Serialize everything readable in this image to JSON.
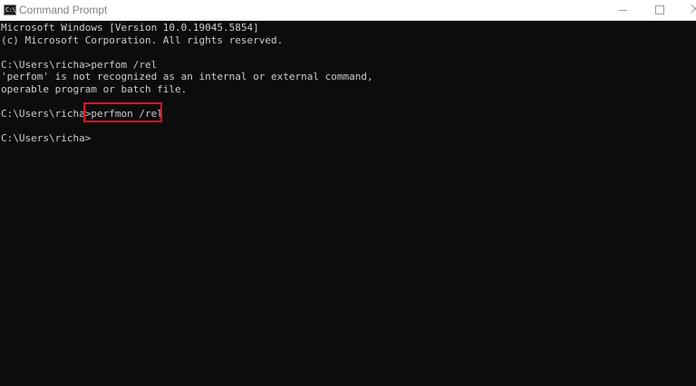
{
  "window": {
    "title": "Command Prompt",
    "app_icon_glyph": "C:\\"
  },
  "console": {
    "lines": [
      "Microsoft Windows [Version 10.0.19045.5854]",
      "(c) Microsoft Corporation. All rights reserved.",
      "C:\\Users\\richa>perfom /rel",
      "'perfom' is not recognized as an internal or external command,",
      "operable program or batch file.",
      "C:\\Users\\richa>perfmon /rel",
      "C:\\Users\\richa>"
    ]
  },
  "colors": {
    "console_background": "#0c0c0c",
    "console_text": "#cccccc",
    "highlight_border": "#e81123",
    "titlebar_background": "#ffffff",
    "titlebar_text": "#808080"
  },
  "icons": {
    "app": "command-prompt-icon",
    "minimize": "minimize-icon",
    "maximize": "maximize-icon",
    "close": "close-icon"
  }
}
